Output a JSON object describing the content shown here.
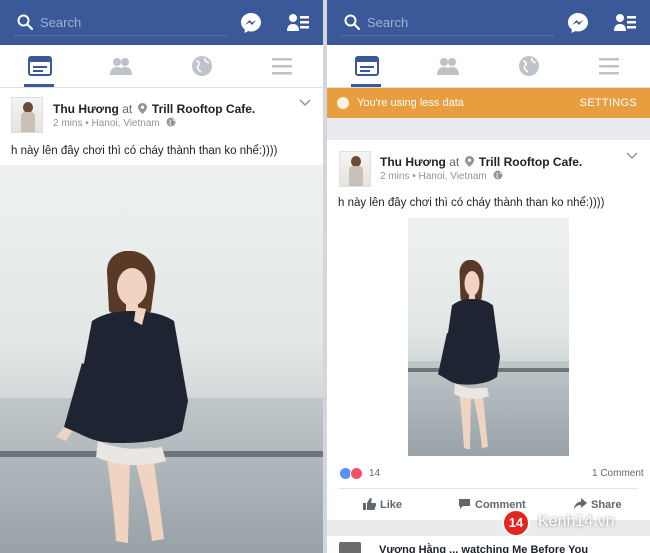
{
  "colors": {
    "topbar": "#3b5998",
    "banner": "#e89e3e",
    "accent": "#3b5998"
  },
  "left": {
    "search": {
      "placeholder": "Search"
    },
    "nav": {
      "icons": [
        "news-feed-icon",
        "friends-icon",
        "globe-icon",
        "menu-icon"
      ],
      "active": 0
    },
    "post": {
      "author": "Thu Hương",
      "at": "at",
      "place": "Trill Rooftop Cafe.",
      "time": "2 mins",
      "location": "Hanoi, Vietnam",
      "text": "h này lên đây chơi thì có cháy thành than ko nhể:))))"
    }
  },
  "right": {
    "search": {
      "placeholder": "Search"
    },
    "nav": {
      "icons": [
        "news-feed-icon",
        "friends-icon",
        "globe-icon",
        "menu-icon"
      ],
      "active": 0
    },
    "banner": {
      "text": "You're using less data",
      "settings": "SETTINGS"
    },
    "post": {
      "author": "Thu Hương",
      "at": "at",
      "place": "Trill Rooftop Cafe.",
      "time": "2 mins",
      "location": "Hanoi, Vietnam",
      "text": "h này lên đây chơi thì có cháy thành than ko nhể:))))",
      "reactions_count": "14",
      "comments": "1 Comment",
      "actions": {
        "like": "Like",
        "comment": "Comment",
        "share": "Share"
      }
    },
    "next_post": {
      "text": "Vương Hằng ... watching Me Before You"
    }
  },
  "watermark": {
    "badge": "14",
    "text": "Kenh14.vn"
  }
}
